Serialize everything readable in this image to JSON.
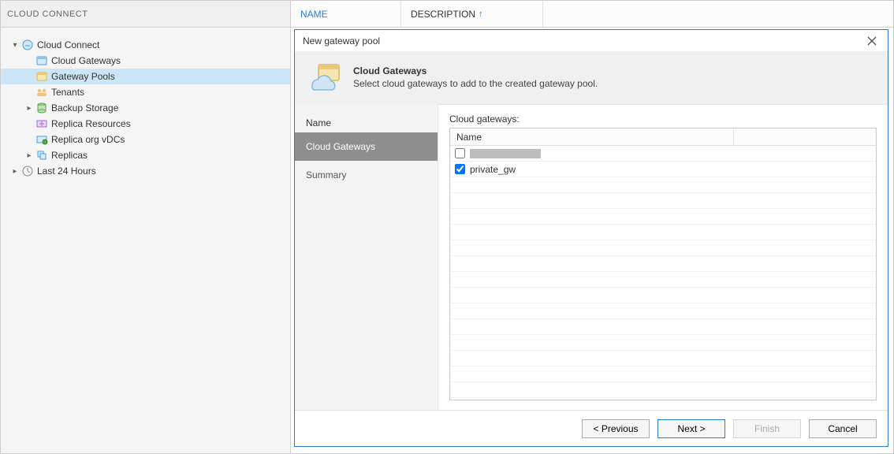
{
  "left": {
    "header": "CLOUD CONNECT",
    "nodes": [
      {
        "label": "Cloud Connect",
        "depth": 0,
        "expander": "▾",
        "icon": "cloud-connect-icon",
        "selected": false
      },
      {
        "label": "Cloud Gateways",
        "depth": 1,
        "expander": "",
        "icon": "cloud-gateways-icon",
        "selected": false
      },
      {
        "label": "Gateway Pools",
        "depth": 1,
        "expander": "",
        "icon": "gateway-pools-icon",
        "selected": true
      },
      {
        "label": "Tenants",
        "depth": 1,
        "expander": "",
        "icon": "tenants-icon",
        "selected": false
      },
      {
        "label": "Backup Storage",
        "depth": 1,
        "expander": "▸",
        "icon": "backup-storage-icon",
        "selected": false
      },
      {
        "label": "Replica Resources",
        "depth": 1,
        "expander": "",
        "icon": "replica-resources-icon",
        "selected": false
      },
      {
        "label": "Replica org vDCs",
        "depth": 1,
        "expander": "",
        "icon": "replica-vdcs-icon",
        "selected": false
      },
      {
        "label": "Replicas",
        "depth": 1,
        "expander": "▸",
        "icon": "replicas-icon",
        "selected": false
      },
      {
        "label": "Last 24 Hours",
        "depth": 0,
        "expander": "▸",
        "icon": "last24-icon",
        "selected": false
      }
    ]
  },
  "columns": {
    "name": "NAME",
    "description": "DESCRIPTION",
    "sorted": "description"
  },
  "dialog": {
    "title": "New gateway pool",
    "head_title": "Cloud Gateways",
    "head_desc": "Select cloud gateways to add to the created gateway pool.",
    "steps_header": "Name",
    "steps": [
      {
        "label": "Cloud Gateways",
        "current": true
      },
      {
        "label": "Summary",
        "current": false
      }
    ],
    "grid_label": "Cloud gateways:",
    "grid_cols": {
      "name": "Name"
    },
    "rows": [
      {
        "label": "",
        "checked": false,
        "redacted": true
      },
      {
        "label": "private_gw",
        "checked": true,
        "redacted": false
      }
    ],
    "buttons": {
      "previous": "< Previous",
      "next": "Next >",
      "finish": "Finish",
      "cancel": "Cancel"
    }
  }
}
